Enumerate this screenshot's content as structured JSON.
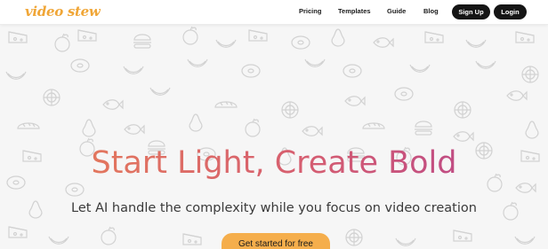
{
  "brand": {
    "logo_text": "video stew",
    "accent_color": "#f0a637"
  },
  "nav": {
    "links": [
      "Pricing",
      "Templates",
      "Guide",
      "Blog"
    ],
    "signup_label": "Sign Up",
    "login_label": "Login"
  },
  "hero": {
    "title": "Start Light, Create Bold",
    "subtitle": "Let AI handle the complexity while you focus on video creation",
    "cta_label": "Get started for free",
    "cta_color": "#f5ae4c",
    "background_pattern": "food-doodle-pattern"
  }
}
